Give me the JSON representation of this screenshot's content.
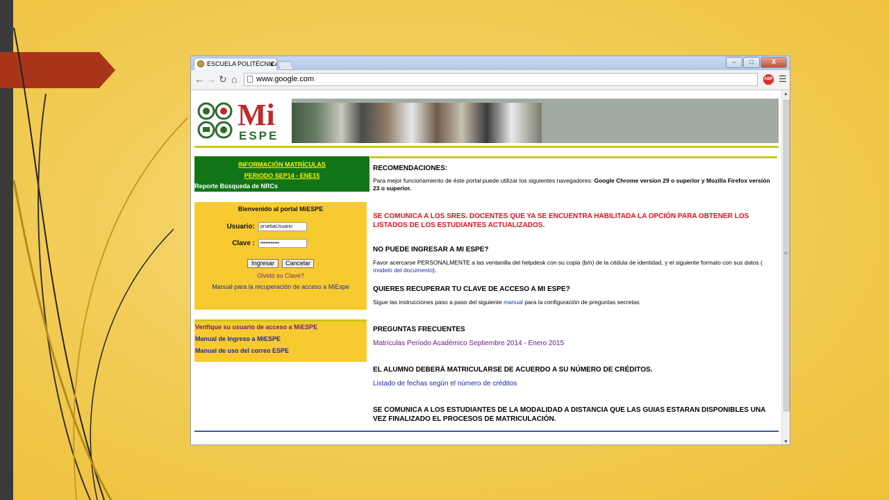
{
  "browser": {
    "tab_title": "ESCUELA POLITÉCNICA D",
    "tab_close": "x",
    "url": "www.google.com",
    "controls": {
      "minimize": "–",
      "maximize": "□",
      "close": "X"
    },
    "adblock_label": "ABP"
  },
  "logo": {
    "mi": "Mi",
    "espe": "ESPE"
  },
  "sidebar": {
    "info_link_1": "INFORMACIÓN MATRÍCULAS",
    "info_link_2": "PERIODO SEP14 - ENE15",
    "nrc_link": "Reporte Búsqueda de NRCs",
    "login": {
      "title": "Bienvenido al portal MiESPE",
      "user_label": "Usuario:",
      "user_value": "pruebaUsuario",
      "pass_label": "Clave :",
      "pass_value": "•••••••••••",
      "submit": "Ingresar",
      "cancel": "Cancelar",
      "forgot": "Olvidó su Clave?",
      "recovery_manual": "Manual para la recuperación de acceso a MiEspe"
    },
    "links": [
      "Verifique su usuario de acceso a MiESPE",
      "Manual de Ingreso a MiESPE",
      "Manual de uso del correo ESPE"
    ]
  },
  "content": {
    "rec_heading": "RECOMENDACIONES:",
    "rec_text_1": "Para mejor funcionamiento de éste portal puede utilizar los siguientes navegadores: ",
    "rec_text_bold": "Google Chrome version 29 o superior y Mozilla Firefox versión 23 o superior.",
    "notice_docentes": "SE COMUNICA A LOS SRES. DOCENTES QUE YA SE ENCUENTRA HABILITADA LA OPCIÓN PARA OBTENER LOS LISTADOS DE LOS ESTUDIANTES ACTUALIZADOS.",
    "no_login_heading": "NO PUEDE INGRESAR A MI ESPE?",
    "no_login_text": "Favor acercarse PERSONALMENTE a las ventanilla del helpdesk con su copia (b/n) de la cédula de identidad, y el siguiente formato con sus datos (",
    "no_login_link": " modelo del documento",
    "no_login_end": ").",
    "recover_heading": "QUIERES RECUPERAR TU CLAVE DE ACCESO A MI ESPE?",
    "recover_text_1": "Sigue las instrucciones paso a paso del siguiente ",
    "recover_link": "manual",
    "recover_text_2": " para la configuración de preguntas secretas",
    "faq_heading": "PREGUNTAS FRECUENTES",
    "faq_link": "Matrículas Período Académico Septiembre 2014 - Enero 2015",
    "credits_heading": "EL ALUMNO DEBERÁ MATRICULARSE DE ACUERDO A SU NÚMERO DE CRÉDITOS.",
    "credits_link": "Listado de fechas según el número de créditos",
    "distance_notice": "SE COMUNICA A LOS ESTUDIANTES DE LA MODALIDAD A DISTANCIA QUE LAS GUIAS ESTARAN DISPONIBLES UNA VEZ FINALIZADO EL PROCESOS DE MATRICULACIÓN."
  }
}
